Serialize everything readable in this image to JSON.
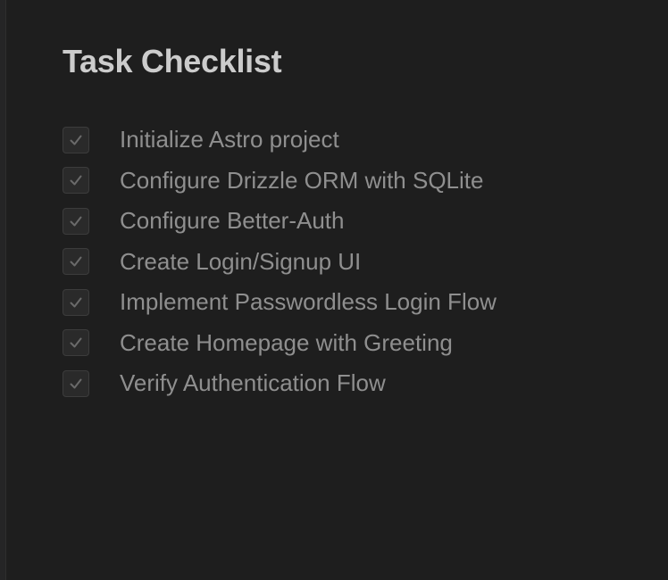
{
  "checklist": {
    "title": "Task Checklist",
    "items": [
      {
        "label": "Initialize Astro project",
        "checked": true
      },
      {
        "label": "Configure Drizzle ORM with SQLite",
        "checked": true
      },
      {
        "label": "Configure Better-Auth",
        "checked": true
      },
      {
        "label": "Create Login/Signup UI",
        "checked": true
      },
      {
        "label": "Implement Passwordless Login Flow",
        "checked": true
      },
      {
        "label": "Create Homepage with Greeting",
        "checked": true
      },
      {
        "label": "Verify Authentication Flow",
        "checked": true
      }
    ]
  },
  "colors": {
    "background": "#1e1e1e",
    "title": "#cccccc",
    "label": "#8f8f8f",
    "checkmark": "#6a6a6a"
  }
}
